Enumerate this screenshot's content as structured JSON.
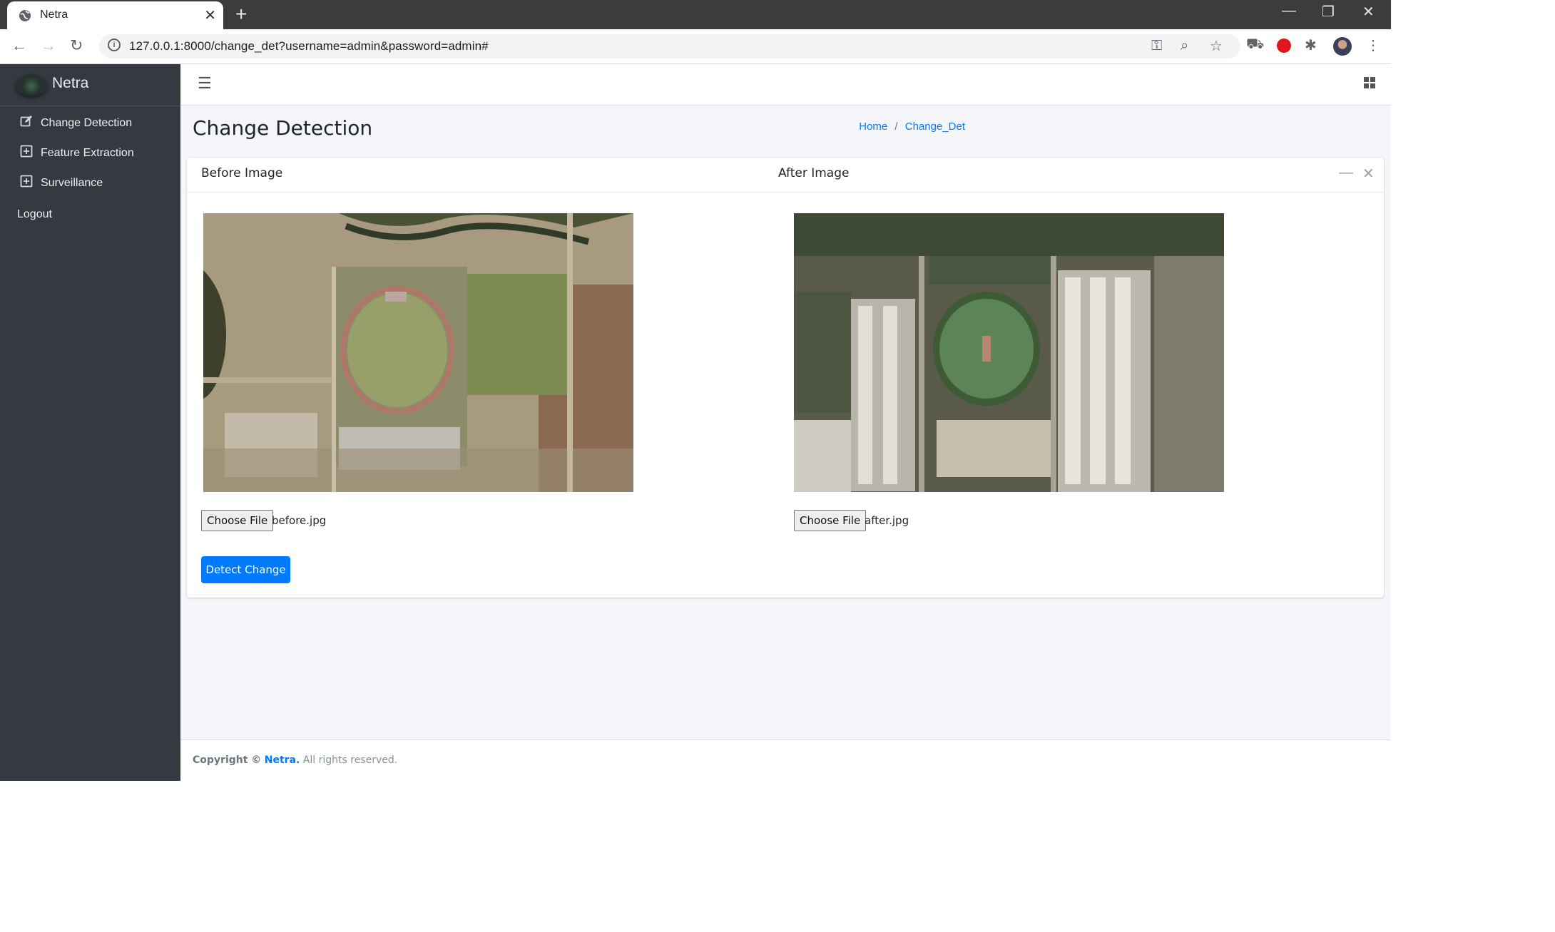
{
  "browser": {
    "tab_title": "Netra",
    "new_tab_icon": "plus-icon",
    "url": "127.0.0.1:8000/change_det?username=admin&password=admin#"
  },
  "sidebar": {
    "brand": "Netra",
    "items": [
      {
        "label": "Change Detection",
        "icon": "edit-icon"
      },
      {
        "label": "Feature Extraction",
        "icon": "plus-square-icon"
      },
      {
        "label": "Surveillance",
        "icon": "plus-square-icon"
      },
      {
        "label": "Logout"
      }
    ]
  },
  "header": {
    "title": "Change Detection",
    "breadcrumb": {
      "home": "Home",
      "separator": "/",
      "current": "Change_Det"
    }
  },
  "card": {
    "before_label": "Before Image",
    "after_label": "After Image",
    "before_file_button": "Choose File",
    "before_file_name": "before.jpg",
    "after_file_button": "Choose File",
    "after_file_name": "after.jpg",
    "detect_button": "Detect Change"
  },
  "footer": {
    "prefix": "Copyright ©",
    "brand": "Netra.",
    "suffix": "All rights reserved."
  },
  "colors": {
    "accent": "#007bff",
    "sidebar_bg": "#343a40",
    "page_bg": "#f4f6f9"
  }
}
